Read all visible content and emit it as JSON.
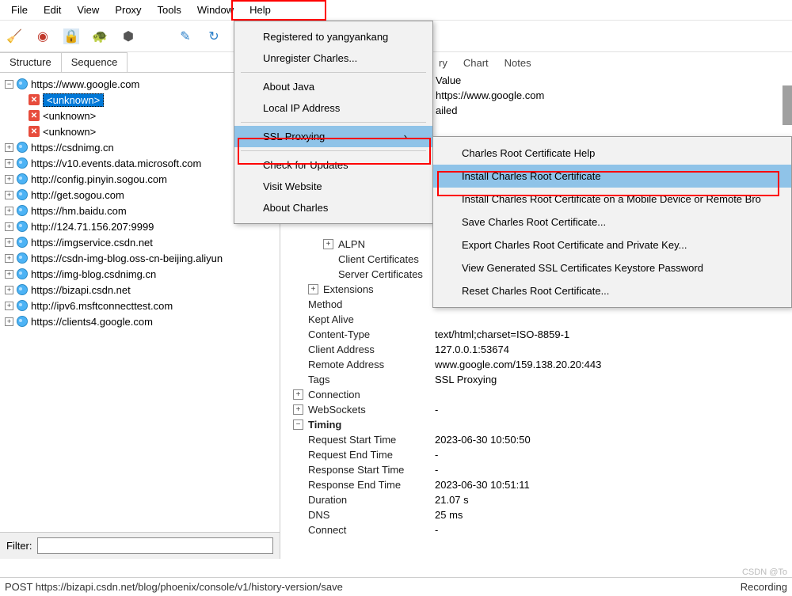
{
  "menu": [
    "File",
    "Edit",
    "View",
    "Proxy",
    "Tools",
    "Window",
    "Help"
  ],
  "tabs_left": [
    "Structure",
    "Sequence"
  ],
  "tabs_right_partial": [
    "ry",
    "Chart",
    "Notes"
  ],
  "tree": {
    "google": "https://www.google.com",
    "unknown": "<unknown>",
    "hosts": [
      "https://csdnimg.cn",
      "https://v10.events.data.microsoft.com",
      "http://config.pinyin.sogou.com",
      "http://get.sogou.com",
      "https://hm.baidu.com",
      "http://124.71.156.207:9999",
      "https://imgservice.csdn.net",
      "https://csdn-img-blog.oss-cn-beijing.aliyun",
      "https://img-blog.csdnimg.cn",
      "https://bizapi.csdn.net",
      "http://ipv6.msftconnecttest.com",
      "https://clients4.google.com"
    ]
  },
  "help_menu": {
    "registered": "Registered to yangyankang",
    "unregister": "Unregister Charles...",
    "about_java": "About Java",
    "local_ip": "Local IP Address",
    "ssl": "SSL Proxying",
    "check": "Check for Updates",
    "visit": "Visit Website",
    "about": "About Charles"
  },
  "ssl_submenu": {
    "help": "Charles Root Certificate Help",
    "install": "Install Charles Root Certificate",
    "install_mobile": "Install Charles Root Certificate on a Mobile Device or Remote Bro",
    "save": "Save Charles Root Certificate...",
    "export": "Export Charles Root Certificate and Private Key...",
    "view_keystore": "View Generated SSL Certificates Keystore Password",
    "reset": "Reset Charles Root Certificate..."
  },
  "details_top": {
    "value_lbl": "Value",
    "url_val": "https://www.google.com",
    "failed": "ailed"
  },
  "details": {
    "alpn": "ALPN",
    "client_cert": "Client Certificates",
    "server_cert": "Server Certificates",
    "extensions": "Extensions",
    "method": "Method",
    "kept": "Kept Alive",
    "ctype": "Content-Type",
    "ctype_v": "text/html;charset=ISO-8859-1",
    "caddr": "Client Address",
    "caddr_v": "127.0.0.1:53674",
    "raddr": "Remote Address",
    "raddr_v": "www.google.com/159.138.20.20:443",
    "tags": "Tags",
    "tags_v": "SSL Proxying",
    "conn": "Connection",
    "ws": "WebSockets",
    "ws_v": "-",
    "timing": "Timing",
    "rst": "Request Start Time",
    "rst_v": "2023-06-30 10:50:50",
    "ret": "Request End Time",
    "ret_v": "-",
    "resst": "Response Start Time",
    "resst_v": "-",
    "reset": "Response End Time",
    "reset_v": "2023-06-30 10:51:11",
    "dur": "Duration",
    "dur_v": "21.07 s",
    "dns": "DNS",
    "dns_v": "25 ms",
    "connect": "Connect",
    "connect_v": "-"
  },
  "filter_label": "Filter:",
  "status_text": "POST https://bizapi.csdn.net/blog/phoenix/console/v1/history-version/save",
  "status_right": "Recording",
  "watermark": "CSDN @To"
}
